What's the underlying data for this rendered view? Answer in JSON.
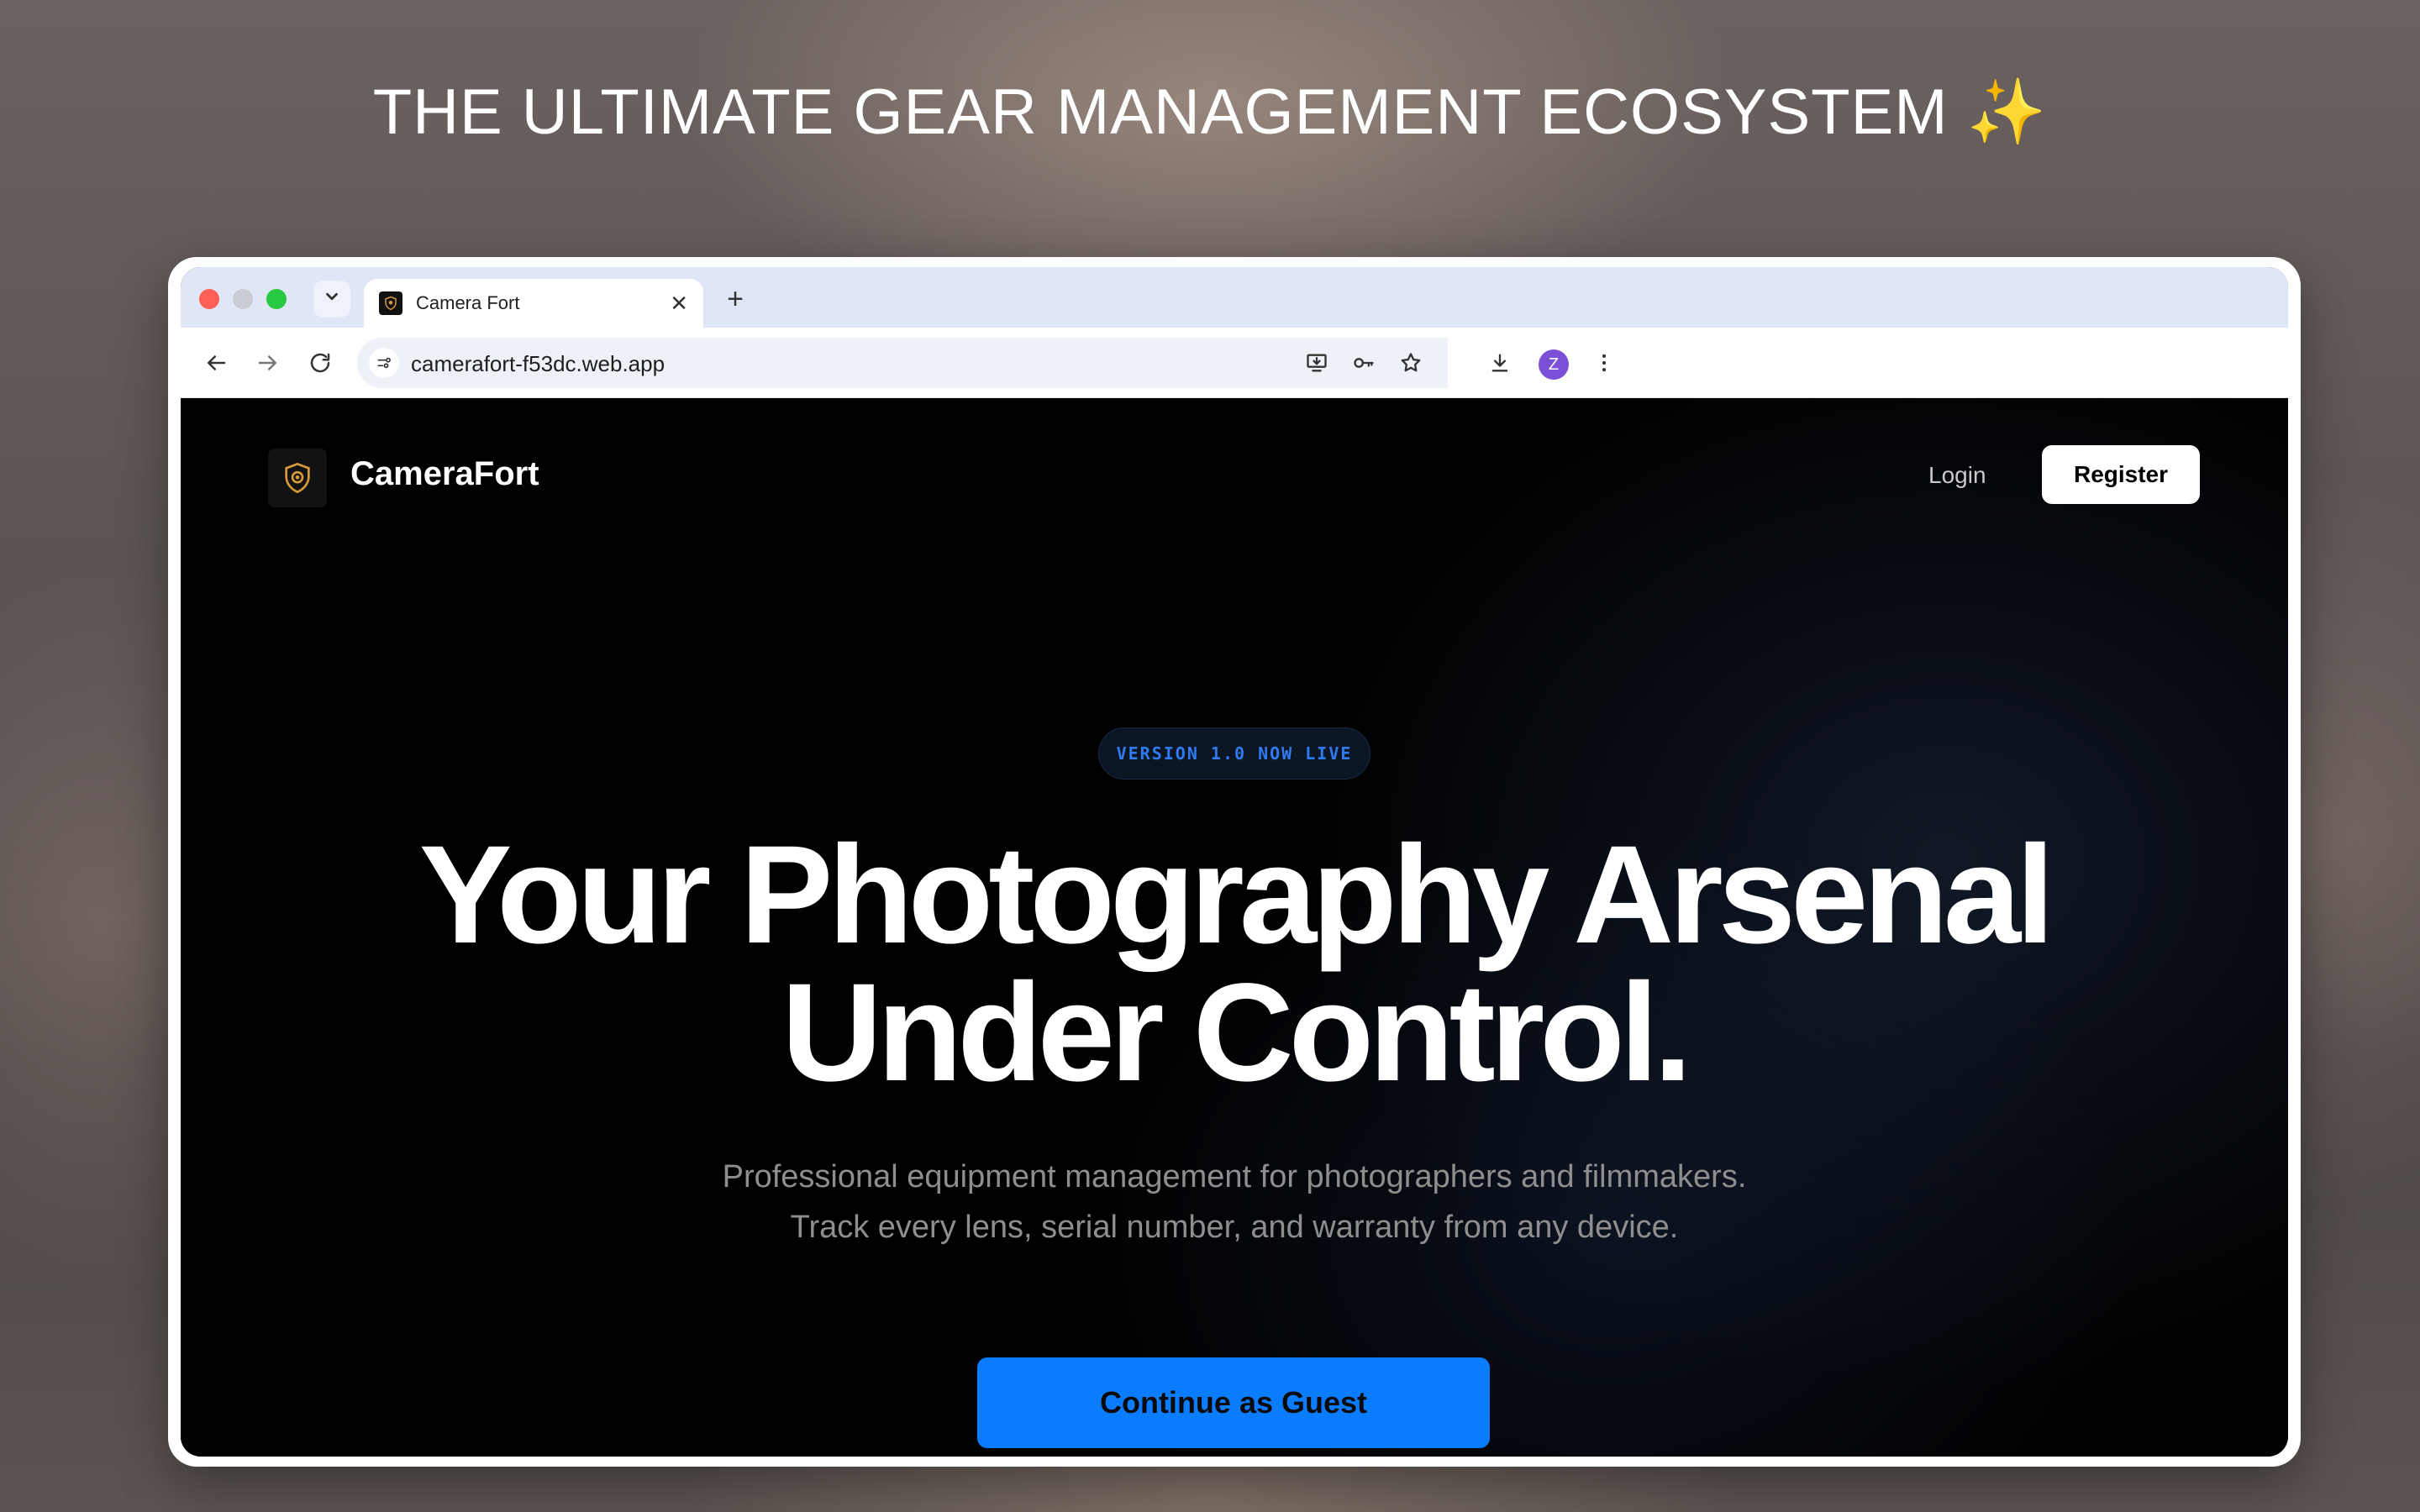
{
  "headline": {
    "text": "THE ULTIMATE GEAR MANAGEMENT ECOSYSTEM ✨"
  },
  "browser": {
    "tab_title": "Camera Fort",
    "tab_close": "✕",
    "new_tab": "+",
    "url": "camerafort-f53dc.web.app",
    "profile_initial": "Z"
  },
  "site": {
    "brand": "CameraFort",
    "nav": {
      "login": "Login",
      "register": "Register"
    },
    "badge": "VERSION 1.0 NOW LIVE",
    "hero_line1": "Your Photography Arsenal",
    "hero_line2": "Under Control.",
    "subtitle_line1": "Professional equipment management for photographers and filmmakers.",
    "subtitle_line2": "Track every lens, serial number, and warranty from any device.",
    "cta": "Continue as Guest"
  },
  "colors": {
    "accent": "#0a7cff",
    "badge_text": "#2f7bf0",
    "logo_gold": "#d69a3a",
    "avatar": "#7b4fd6"
  }
}
